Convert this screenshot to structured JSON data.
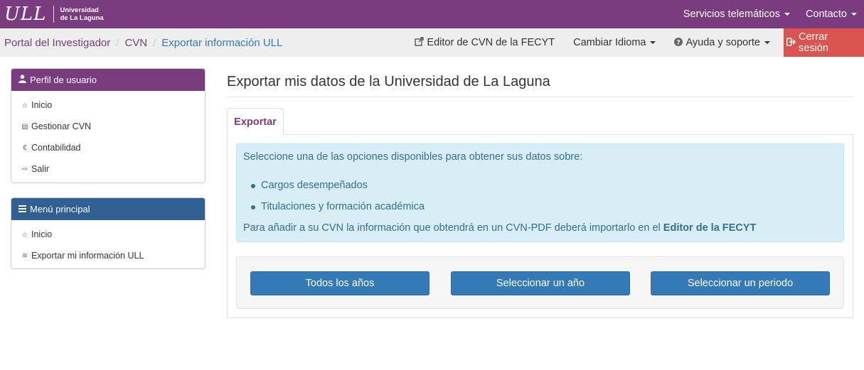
{
  "brand": {
    "logo_mark": "ULL",
    "logo_line1": "Universidad",
    "logo_line2": "de La Laguna"
  },
  "topnav": {
    "services": "Servicios telemáticos",
    "contact": "Contacto"
  },
  "breadcrumb": {
    "items": [
      "Portal del Investigador",
      "CVN",
      "Exportar información ULL"
    ],
    "separator": "/"
  },
  "subnav": {
    "editor": "Editor de CVN de la FECYT",
    "language": "Cambiar Idioma",
    "help": "Ayuda y soporte",
    "logout": "Cerrar sesión"
  },
  "profile_panel": {
    "title": "Perfil de usuario",
    "items": [
      {
        "label": "Inicio",
        "icon": "home-icon"
      },
      {
        "label": "Gestionar CVN",
        "icon": "book-icon"
      },
      {
        "label": "Contabilidad",
        "icon": "euro-icon"
      },
      {
        "label": "Salir",
        "icon": "logout-icon"
      }
    ]
  },
  "main_menu_panel": {
    "title": "Menú principal",
    "items": [
      {
        "label": "Inicio",
        "icon": "home-icon"
      },
      {
        "label": "Exportar mi información ULL",
        "icon": "database-icon"
      }
    ]
  },
  "main": {
    "title": "Exportar mis datos de la Universidad de La Laguna",
    "tab": "Exportar",
    "alert_intro": "Seleccione una de las opciones disponibles para obtener sus datos sobre:",
    "alert_items": [
      "Cargos desempeñados",
      "Titulaciones y formación académica"
    ],
    "alert_note": "Para añadir a su CVN la información que obtendrá en un CVN-PDF deberá importarlo en el ",
    "alert_note_bold": "Editor de la FECYT",
    "buttons": [
      "Todos los años",
      "Seleccionar un año",
      "Seleccionar un periodo"
    ]
  },
  "colors": {
    "brand": "#7a3b7f",
    "menu_head": "#2f5f93",
    "logout": "#d9534f",
    "button": "#337ab7",
    "alert_bg": "#d9edf7"
  }
}
